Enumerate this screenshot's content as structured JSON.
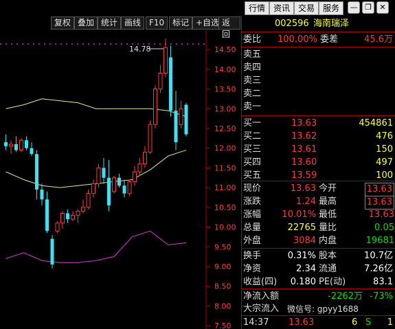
{
  "top_buttons": [
    "行情",
    "资讯",
    "交易",
    "服务"
  ],
  "toolbar": [
    "复权",
    "叠加",
    "统计",
    "画线",
    "F10",
    "标记",
    "+自选",
    "返回"
  ],
  "stock": {
    "code": "002596",
    "name": "海南瑞泽"
  },
  "weibi": {
    "label1": "委比",
    "value1": "100.00%",
    "label2": "委差",
    "value2": "45.6万"
  },
  "sell": [
    {
      "label": "卖五"
    },
    {
      "label": "卖四"
    },
    {
      "label": "卖三"
    },
    {
      "label": "卖二"
    },
    {
      "label": "卖一"
    }
  ],
  "buy": [
    {
      "label": "买一",
      "price": "13.63",
      "vol": "454861"
    },
    {
      "label": "买二",
      "price": "13.62",
      "vol": "476"
    },
    {
      "label": "买三",
      "price": "13.61",
      "vol": "150"
    },
    {
      "label": "买四",
      "price": "13.60",
      "vol": "497"
    },
    {
      "label": "买五",
      "price": "13.59",
      "vol": "100"
    }
  ],
  "quote": [
    {
      "l1": "现价",
      "v1": "13.63",
      "l2": "今开",
      "v2": "13.63"
    },
    {
      "l1": "涨跌",
      "v1": "1.24",
      "l2": "最高",
      "v2": "13.63"
    },
    {
      "l1": "涨幅",
      "v1": "10.01%",
      "l2": "最低",
      "v2": "13.63"
    },
    {
      "l1": "总量",
      "v1": "22765",
      "l2": "量比",
      "v2": "0.05"
    },
    {
      "l1": "外盘",
      "v1": "3084",
      "l2": "内盘",
      "v2": "19681"
    }
  ],
  "fund": [
    {
      "l1": "换手",
      "v1": "0.31%",
      "l2": "股本",
      "v2": "10.7亿"
    },
    {
      "l1": "净资",
      "v1": "2.34",
      "l2": "流通",
      "v2": "7.26亿"
    },
    {
      "l1": "收益(四)",
      "v1": "0.180",
      "l2": "PE(动)",
      "v2": "83.1"
    }
  ],
  "flow": [
    {
      "label": "净流入额",
      "value": "-2262万",
      "pct": "-73%"
    },
    {
      "label": "大宗流入",
      "value": "",
      "pct": ""
    }
  ],
  "tick": {
    "time": "14:37",
    "price": "13.63",
    "vol": "6",
    "side": "S",
    "n": "1"
  },
  "watermark": "微信号: gpyy1688",
  "chart_data": {
    "type": "candlestick",
    "high_label": "14.78",
    "y_ticks": [
      "14.50",
      "14.00",
      "13.50",
      "13.00",
      "12.50",
      "12.00",
      "11.50",
      "11.00",
      "10.50",
      "10.00",
      "9.50",
      "9.00",
      "8.50",
      "8.00",
      "7.50"
    ],
    "ylim": [
      7.45,
      14.85
    ],
    "candles": [
      {
        "o": 12.15,
        "h": 12.35,
        "l": 11.95,
        "c": 12.05
      },
      {
        "o": 12.05,
        "h": 12.2,
        "l": 11.85,
        "c": 12.1
      },
      {
        "o": 12.1,
        "h": 12.3,
        "l": 11.9,
        "c": 11.95
      },
      {
        "o": 11.95,
        "h": 12.25,
        "l": 11.9,
        "c": 12.2
      },
      {
        "o": 12.2,
        "h": 12.3,
        "l": 11.95,
        "c": 12.0
      },
      {
        "o": 12.0,
        "h": 12.15,
        "l": 11.8,
        "c": 11.85
      },
      {
        "o": 11.85,
        "h": 11.95,
        "l": 10.7,
        "c": 10.95
      },
      {
        "o": 10.95,
        "h": 11.1,
        "l": 10.55,
        "c": 10.7
      },
      {
        "o": 10.7,
        "h": 10.9,
        "l": 9.85,
        "c": 9.9
      },
      {
        "o": 9.7,
        "h": 9.8,
        "l": 8.95,
        "c": 9.05
      },
      {
        "o": 9.9,
        "h": 10.15,
        "l": 9.85,
        "c": 10.1
      },
      {
        "o": 10.1,
        "h": 10.4,
        "l": 9.95,
        "c": 10.35
      },
      {
        "o": 10.35,
        "h": 10.45,
        "l": 10.1,
        "c": 10.2
      },
      {
        "o": 10.2,
        "h": 10.4,
        "l": 10.15,
        "c": 10.3
      },
      {
        "o": 10.3,
        "h": 10.45,
        "l": 10.1,
        "c": 10.4
      },
      {
        "o": 10.4,
        "h": 10.7,
        "l": 10.35,
        "c": 10.5
      },
      {
        "o": 10.5,
        "h": 10.95,
        "l": 10.45,
        "c": 10.85
      },
      {
        "o": 10.85,
        "h": 11.2,
        "l": 10.75,
        "c": 11.1
      },
      {
        "o": 11.1,
        "h": 11.6,
        "l": 11.0,
        "c": 11.5
      },
      {
        "o": 11.5,
        "h": 11.75,
        "l": 11.1,
        "c": 11.25
      },
      {
        "o": 11.25,
        "h": 11.7,
        "l": 10.4,
        "c": 10.55
      },
      {
        "o": 10.9,
        "h": 11.3,
        "l": 10.85,
        "c": 11.25
      },
      {
        "o": 11.25,
        "h": 11.35,
        "l": 11.0,
        "c": 11.05
      },
      {
        "o": 11.05,
        "h": 11.2,
        "l": 10.75,
        "c": 10.85
      },
      {
        "o": 10.85,
        "h": 11.2,
        "l": 10.8,
        "c": 11.15
      },
      {
        "o": 11.15,
        "h": 11.55,
        "l": 11.05,
        "c": 11.4
      },
      {
        "o": 11.4,
        "h": 11.75,
        "l": 11.3,
        "c": 11.6
      },
      {
        "o": 11.6,
        "h": 12.05,
        "l": 11.5,
        "c": 11.9
      },
      {
        "o": 11.9,
        "h": 12.7,
        "l": 11.85,
        "c": 12.6
      },
      {
        "o": 12.6,
        "h": 13.6,
        "l": 12.5,
        "c": 13.5
      },
      {
        "o": 13.5,
        "h": 14.1,
        "l": 13.4,
        "c": 13.9
      },
      {
        "o": 13.9,
        "h": 14.78,
        "l": 13.8,
        "c": 14.55
      },
      {
        "o": 14.3,
        "h": 14.6,
        "l": 12.8,
        "c": 12.95
      },
      {
        "o": 12.95,
        "h": 13.45,
        "l": 11.95,
        "c": 12.15
      },
      {
        "o": 12.6,
        "h": 13.2,
        "l": 12.5,
        "c": 13.0
      },
      {
        "o": 13.1,
        "h": 13.15,
        "l": 12.3,
        "c": 12.35
      }
    ],
    "upper_band": [
      13.0,
      13.1,
      13.25,
      13.2,
      13.15,
      13.0,
      13.0,
      13.0,
      13.0,
      12.95,
      12.8
    ],
    "lower_band": [
      9.2,
      9.35,
      9.15,
      9.1,
      9.1,
      9.15,
      9.25,
      9.75,
      9.9,
      9.55,
      9.6
    ],
    "mid_band": [
      11.4,
      11.2,
      11.05,
      11.0,
      11.05,
      11.1,
      11.15,
      11.2,
      11.45,
      11.8,
      11.95
    ]
  }
}
